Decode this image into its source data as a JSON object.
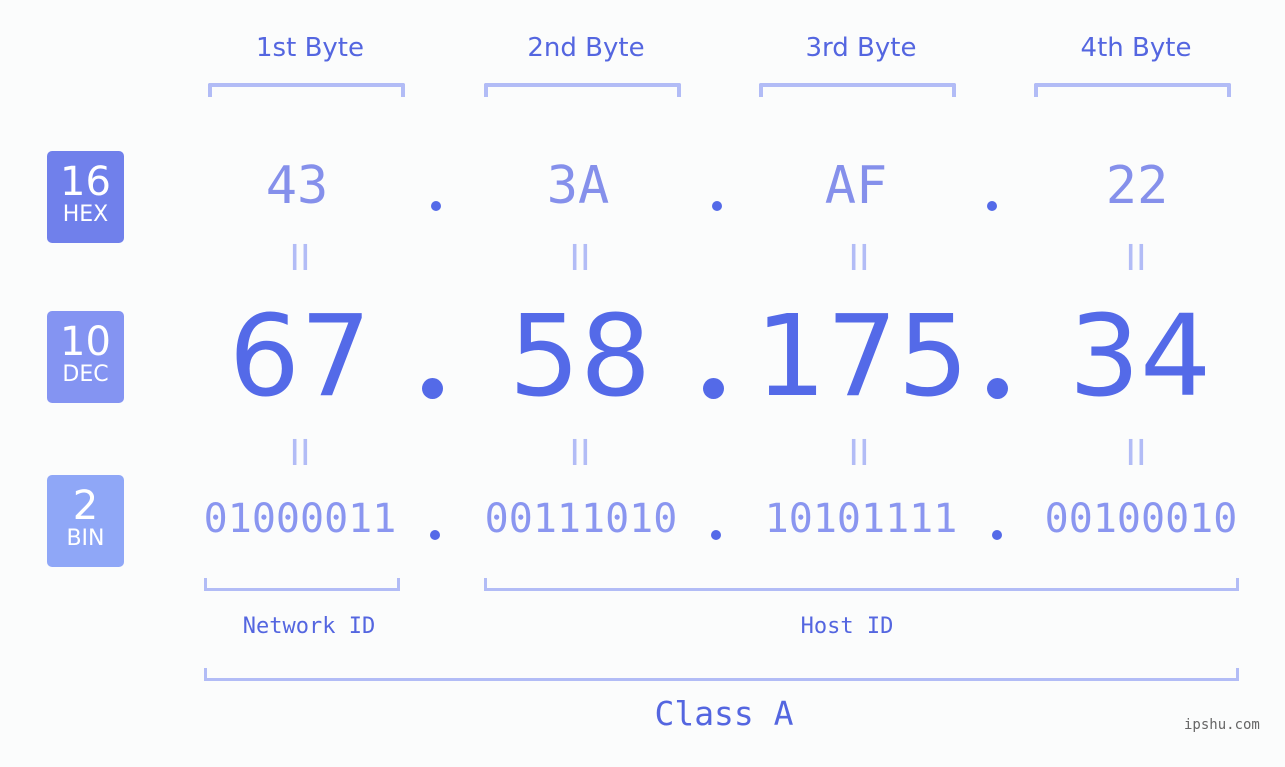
{
  "byte_headers": [
    "1st Byte",
    "2nd Byte",
    "3rd Byte",
    "4th Byte"
  ],
  "bases": [
    {
      "number": "16",
      "label": "HEX",
      "color": "#7080eb"
    },
    {
      "number": "10",
      "label": "DEC",
      "color": "#8494f2"
    },
    {
      "number": "2",
      "label": "BIN",
      "color": "#8fa7f7"
    }
  ],
  "hex": [
    "43",
    "3A",
    "AF",
    "22"
  ],
  "dec": [
    "67",
    "58",
    "175",
    "34"
  ],
  "bin": [
    "01000011",
    "00111010",
    "10101111",
    "00100010"
  ],
  "equals_symbol": "II",
  "network_id_label": "Network ID",
  "host_id_label": "Host ID",
  "class_label": "Class A",
  "watermark": "ipshu.com",
  "colors": {
    "primary": "#546ae8",
    "hex_text": "#8590eb",
    "bin_text": "#8a96f0",
    "bracket": "#b2bcf6"
  }
}
